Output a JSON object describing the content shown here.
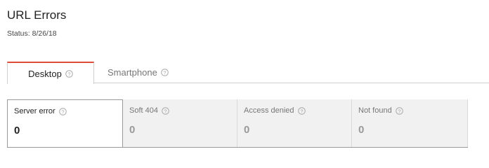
{
  "header": {
    "title": "URL Errors",
    "status": "Status: 8/26/18"
  },
  "tabs": [
    {
      "label": "Desktop",
      "active": true
    },
    {
      "label": "Smartphone",
      "active": false
    }
  ],
  "error_cards": [
    {
      "label": "Server error",
      "value": "0",
      "selected": true
    },
    {
      "label": "Soft 404",
      "value": "0",
      "selected": false
    },
    {
      "label": "Access denied",
      "value": "0",
      "selected": false
    },
    {
      "label": "Not found",
      "value": "0",
      "selected": false
    }
  ],
  "colors": {
    "active_tab_accent": "#dd4b39",
    "card_background": "#f1f1f1",
    "muted_text": "#777777"
  },
  "icons": {
    "help": "question-circle-icon"
  }
}
